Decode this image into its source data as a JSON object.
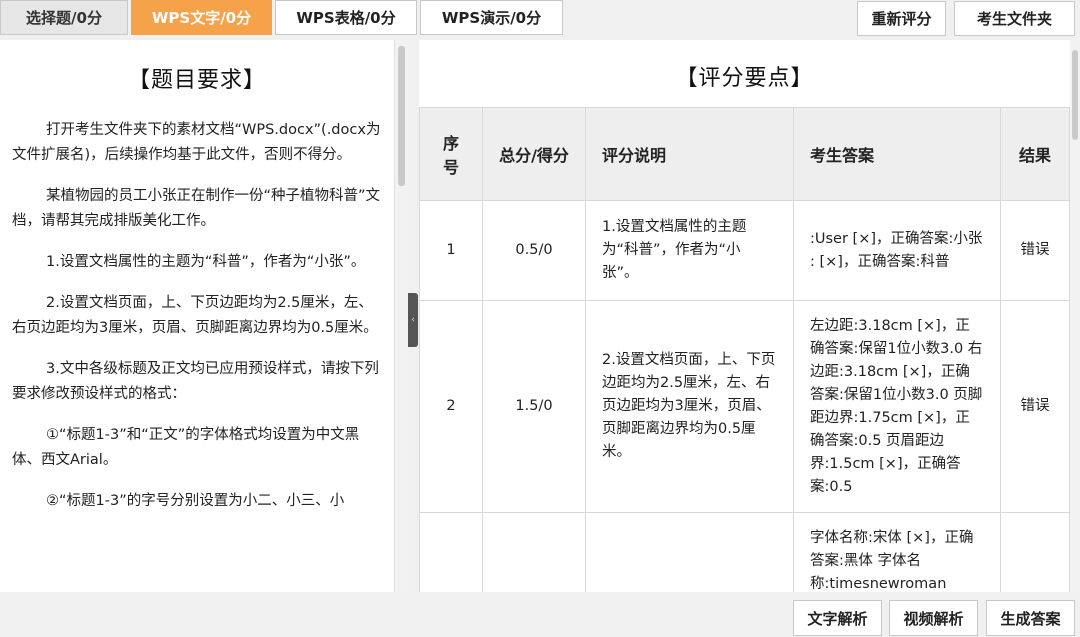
{
  "tabs": [
    {
      "label": "选择题/0分"
    },
    {
      "label": "WPS文字/0分"
    },
    {
      "label": "WPS表格/0分"
    },
    {
      "label": "WPS演示/0分"
    }
  ],
  "toolbar": {
    "rescore_label": "重新评分",
    "exam_folder_label": "考生文件夹"
  },
  "left": {
    "title": "【题目要求】",
    "paragraphs": [
      "打开考生文件夹下的素材文档“WPS.docx”(.docx为文件扩展名)，后续操作均基于此文件，否则不得分。",
      "某植物园的员工小张正在制作一份“种子植物科普”文档，请帮其完成排版美化工作。",
      "1.设置文档属性的主题为“科普”，作者为“小张”。",
      "2.设置文档页面，上、下页边距均为2.5厘米，左、右页边距均为3厘米，页眉、页脚距离边界均为0.5厘米。",
      "3.文中各级标题及正文均已应用预设样式，请按下列要求修改预设样式的格式：",
      "①“标题1-3”和“正文”的字体格式均设置为中文黑体、西文Arial。",
      "②“标题1-3”的字号分别设置为小二、小三、小"
    ]
  },
  "right": {
    "title": "【评分要点】",
    "columns": [
      "序号",
      "总分/得分",
      "评分说明",
      "考生答案",
      "结果"
    ],
    "rows": [
      {
        "seq": "1",
        "score": "0.5/0",
        "desc": "1.设置文档属性的主题为“科普”，作者为“小张”。",
        "answer": ":User [×]，正确答案:小张 : [×]，正确答案:科普",
        "result": "错误"
      },
      {
        "seq": "2",
        "score": "1.5/0",
        "desc": "2.设置文档页面，上、下页边距均为2.5厘米，左、右页边距均为3厘米，页眉、页脚距离边界均为0.5厘米。",
        "answer": "左边距:3.18cm [×]，正确答案:保留1位小数3.0 右边距:3.18cm [×]，正确答案:保留1位小数3.0 页脚距边界:1.75cm [×]，正确答案:0.5 页眉距边界:1.5cm [×]，正确答案:0.5",
        "result": "错误"
      },
      {
        "seq": "",
        "score": "",
        "desc": "",
        "answer": "字体名称:宋体 [×]，正确答案:黑体 字体名称:timesnewroman",
        "result": ""
      }
    ]
  },
  "bottom": {
    "text_analysis_label": "文字解析",
    "video_analysis_label": "视频解析",
    "generate_answer_label": "生成答案"
  }
}
